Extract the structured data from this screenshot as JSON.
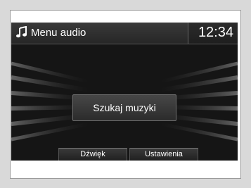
{
  "header": {
    "title": "Menu audio",
    "clock": "12:34",
    "icon": "music-note-icon"
  },
  "main": {
    "search_label": "Szukaj muzyki"
  },
  "softkeys": {
    "sound_label": "Dźwięk",
    "settings_label": "Ustawienia"
  }
}
